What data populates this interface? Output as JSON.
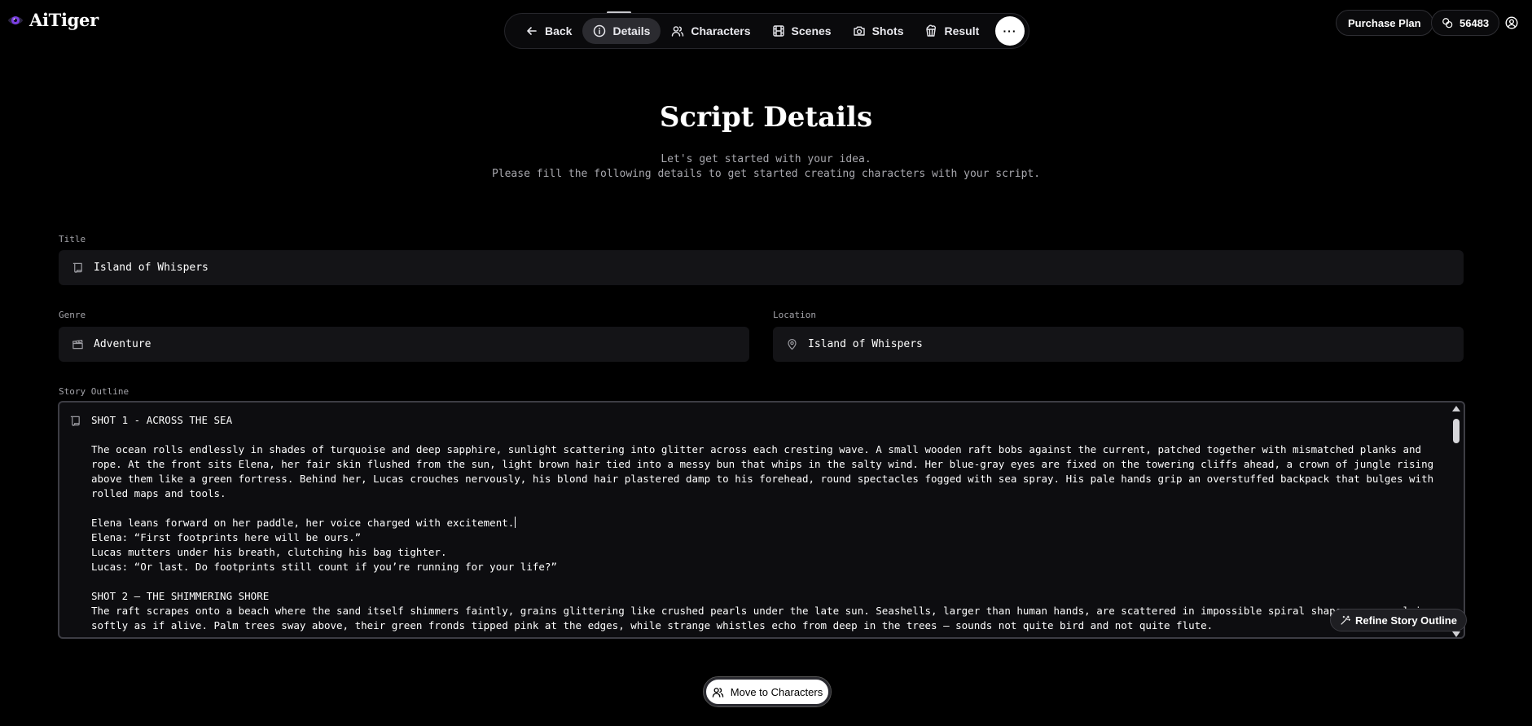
{
  "app": {
    "name": "AiTiger"
  },
  "nav": {
    "items": [
      {
        "label": "Back",
        "icon": "arrow-left-icon"
      },
      {
        "label": "Details",
        "icon": "info-icon",
        "active": true
      },
      {
        "label": "Characters",
        "icon": "users-icon"
      },
      {
        "label": "Scenes",
        "icon": "film-icon"
      },
      {
        "label": "Shots",
        "icon": "camera-icon"
      },
      {
        "label": "Result",
        "icon": "popcorn-icon"
      }
    ],
    "more_label": "···"
  },
  "header": {
    "purchase_label": "Purchase Plan",
    "credits": "56483"
  },
  "page": {
    "title": "Script Details",
    "subtitle_line1": "Let's get started with your idea.",
    "subtitle_line2": "Please fill the following details to get started creating characters with your script."
  },
  "form": {
    "title_label": "Title",
    "title_value": "Island of Whispers",
    "genre_label": "Genre",
    "genre_value": "Adventure",
    "location_label": "Location",
    "location_value": "Island of Whispers",
    "outline_label": "Story Outline",
    "outline": {
      "shot1_heading": "SHOT 1 - ACROSS THE SEA",
      "shot1_paragraph": "The ocean rolls endlessly in shades of turquoise and deep sapphire, sunlight scattering into glitter across each cresting wave. A small wooden raft bobs against the current, patched together with mismatched planks and rope. At the front sits Elena, her fair skin flushed from the sun, light brown hair tied into a messy bun that whips in the salty wind. Her blue-gray eyes are fixed on the towering cliffs ahead, a crown of jungle rising above them like a green fortress. Behind her, Lucas crouches nervously, his blond hair plastered damp to his forehead, round spectacles fogged with sea spray. His pale hands grip an overstuffed backpack that bulges with rolled maps and tools.",
      "line1": "Elena leans forward on her paddle, her voice charged with excitement.",
      "line2": "Elena: “First footprints here will be ours.”",
      "line3": "Lucas mutters under his breath, clutching his bag tighter.",
      "line4": "Lucas: “Or last. Do footprints still count if you’re running for your life?”",
      "shot2_heading": "SHOT 2 — THE SHIMMERING SHORE",
      "shot2_paragraph": "The raft scrapes onto a beach where the sand itself shimmers faintly, grains glittering like crushed pearls under the late sun. Seashells, larger than human hands, are scattered in impossible spiral shapes, some pulsing softly as if alive. Palm trees sway above, their green fronds tipped pink at the edges, while strange whistles echo from deep in the trees — sounds not quite bird and not quite flute."
    },
    "refine_label": "Refine Story Outline"
  },
  "footer": {
    "next_label": "Move to Characters"
  }
}
